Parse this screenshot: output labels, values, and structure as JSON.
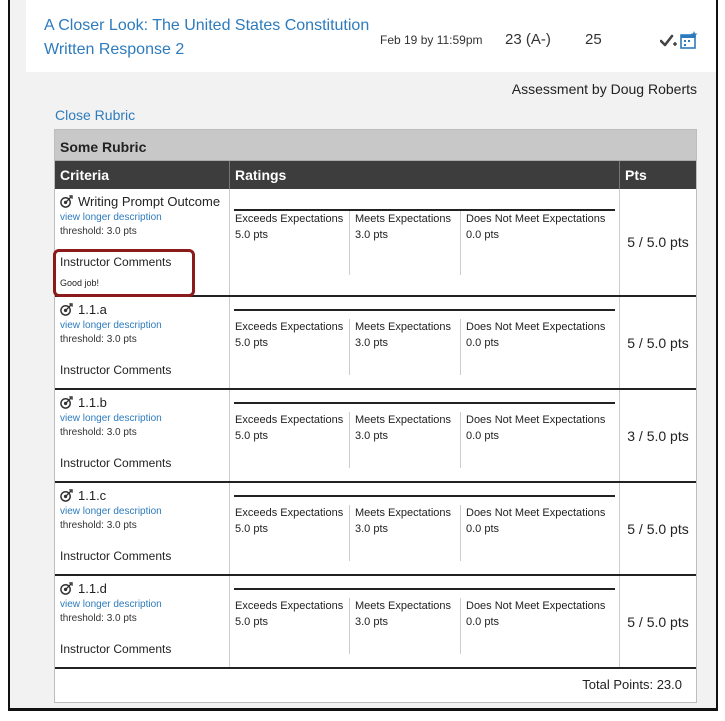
{
  "assignment": {
    "title": "A Closer Look: The United States Constitution Written Response 2",
    "due": "Feb 19 by 11:59pm",
    "score": "23 (A-)",
    "points_possible": "25"
  },
  "assessor": "Assessment by Doug Roberts",
  "close_rubric": "Close Rubric",
  "rubric": {
    "title": "Some Rubric",
    "headers": {
      "criteria": "Criteria",
      "ratings": "Ratings",
      "pts": "Pts"
    },
    "rows": [
      {
        "name": "Writing Prompt Outcome",
        "longer": "view longer description",
        "threshold": "threshold: 3.0 pts",
        "instructor_label": "Instructor Comments",
        "comment": "Good job!",
        "ratings": [
          {
            "label": "Exceeds Expectations",
            "pts": "5.0 pts"
          },
          {
            "label": "Meets Expectations",
            "pts": "3.0 pts"
          },
          {
            "label": "Does Not Meet Expectations",
            "pts": "0.0 pts"
          }
        ],
        "points": "5 / 5.0 pts"
      },
      {
        "name": "1.1.a",
        "longer": "view longer description",
        "threshold": "threshold: 3.0 pts",
        "instructor_label": "Instructor Comments",
        "ratings": [
          {
            "label": "Exceeds Expectations",
            "pts": "5.0 pts"
          },
          {
            "label": "Meets Expectations",
            "pts": "3.0 pts"
          },
          {
            "label": "Does Not Meet Expectations",
            "pts": "0.0 pts"
          }
        ],
        "points": "5 / 5.0 pts"
      },
      {
        "name": "1.1.b",
        "longer": "view longer description",
        "threshold": "threshold: 3.0 pts",
        "instructor_label": "Instructor Comments",
        "ratings": [
          {
            "label": "Exceeds Expectations",
            "pts": "5.0 pts"
          },
          {
            "label": "Meets Expectations",
            "pts": "3.0 pts"
          },
          {
            "label": "Does Not Meet Expectations",
            "pts": "0.0 pts"
          }
        ],
        "points": "3 / 5.0 pts"
      },
      {
        "name": "1.1.c",
        "longer": "view longer description",
        "threshold": "threshold: 3.0 pts",
        "instructor_label": "Instructor Comments",
        "ratings": [
          {
            "label": "Exceeds Expectations",
            "pts": "5.0 pts"
          },
          {
            "label": "Meets Expectations",
            "pts": "3.0 pts"
          },
          {
            "label": "Does Not Meet Expectations",
            "pts": "0.0 pts"
          }
        ],
        "points": "5 / 5.0 pts"
      },
      {
        "name": "1.1.d",
        "longer": "view longer description",
        "threshold": "threshold: 3.0 pts",
        "instructor_label": "Instructor Comments",
        "ratings": [
          {
            "label": "Exceeds Expectations",
            "pts": "5.0 pts"
          },
          {
            "label": "Meets Expectations",
            "pts": "3.0 pts"
          },
          {
            "label": "Does Not Meet Expectations",
            "pts": "0.0 pts"
          }
        ],
        "points": "5 / 5.0 pts"
      }
    ],
    "total": "Total Points: 23.0"
  },
  "colors": {
    "link": "#2d7bbd",
    "header_bg": "#3d3d3d",
    "highlight": "#8b1a1a"
  },
  "icons": [
    "checkmark-plus-icon",
    "calendar-star-icon",
    "target-icon"
  ]
}
